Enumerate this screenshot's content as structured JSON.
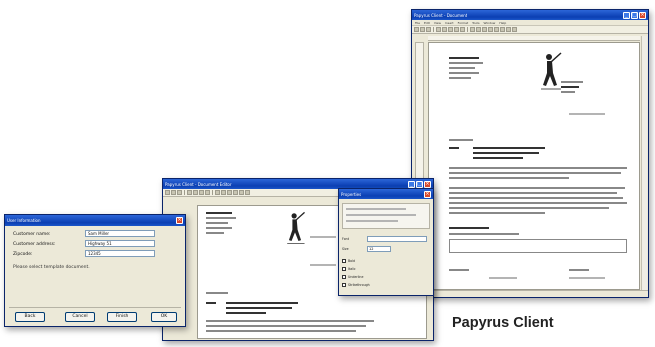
{
  "caption": "Papyrus Client",
  "main_window": {
    "title": "Papyrus Client - Document",
    "menu": [
      "File",
      "Edit",
      "View",
      "Insert",
      "Format",
      "Tools",
      "Window",
      "Help"
    ]
  },
  "editor_window": {
    "title": "Papyrus Client - Document Editor"
  },
  "dialog": {
    "title": "User Information",
    "fields": [
      {
        "label": "Customer name:",
        "value": "Sam Miller"
      },
      {
        "label": "Customer address:",
        "value": "Highway 51"
      },
      {
        "label": "Zipcode:",
        "value": "12345"
      }
    ],
    "note": "Please select template document.",
    "buttons": [
      "Back",
      "Cancel",
      "Finish",
      "OK"
    ]
  },
  "panel": {
    "title": "Properties",
    "font_label": "Font",
    "size_label": "Size",
    "size_value": "12",
    "options": [
      "Bold",
      "Italic",
      "Underline",
      "Strikethrough"
    ]
  },
  "colors": {
    "titlebar": "#0b3fb3",
    "window_face": "#ece9d8",
    "caption_text": "#222222"
  }
}
